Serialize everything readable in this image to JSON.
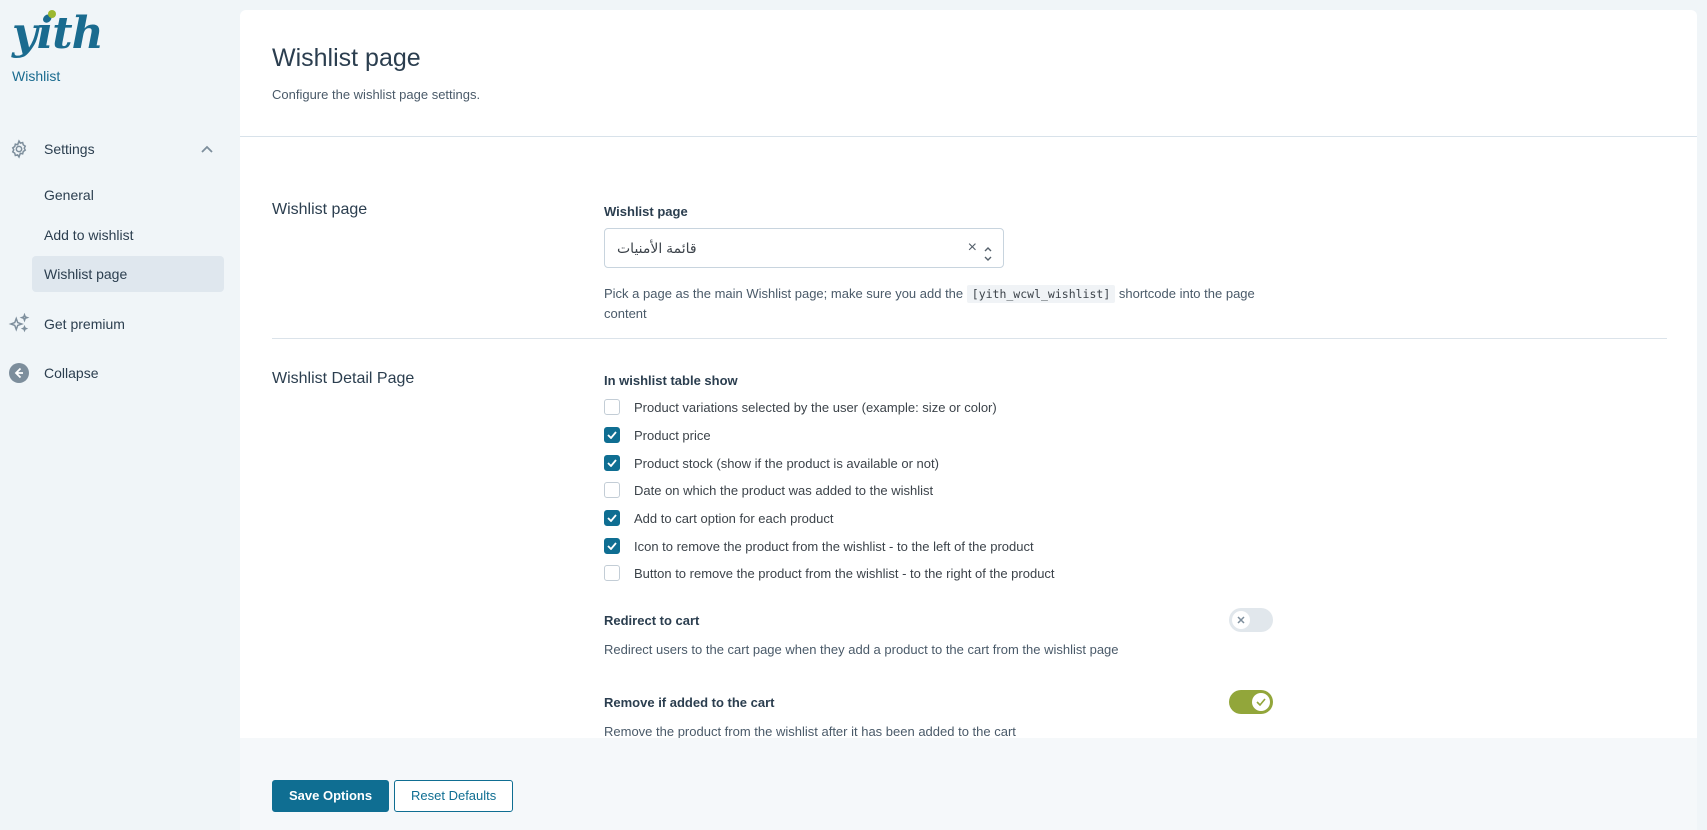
{
  "sidebar": {
    "logo_text": "yith",
    "plugin_name": "Wishlist",
    "settings_label": "Settings",
    "sub_items": [
      "General",
      "Add to wishlist",
      "Wishlist page"
    ],
    "premium_label": "Get premium",
    "collapse_label": "Collapse"
  },
  "header": {
    "title": "Wishlist page",
    "description": "Configure the wishlist page settings."
  },
  "wishlist_page_section": {
    "title": "Wishlist page",
    "field_label": "Wishlist page",
    "selected_value": "قائمة الأمنيات",
    "help_before": "Pick a page as the main Wishlist page; make sure you add the",
    "help_code": "[yith_wcwl_wishlist]",
    "help_after": "shortcode into the page content"
  },
  "detail_section": {
    "title": "Wishlist Detail Page",
    "table_label": "In wishlist table show",
    "options": [
      {
        "label": "Product variations selected by the user (example: size or color)",
        "checked": false
      },
      {
        "label": "Product price",
        "checked": true
      },
      {
        "label": "Product stock (show if the product is available or not)",
        "checked": true
      },
      {
        "label": "Date on which the product was added to the wishlist",
        "checked": false
      },
      {
        "label": "Add to cart option for each product",
        "checked": true
      },
      {
        "label": "Icon to remove the product from the wishlist - to the left of the product",
        "checked": true
      },
      {
        "label": "Button to remove the product from the wishlist - to the right of the product",
        "checked": false
      }
    ],
    "redirect_label": "Redirect to cart",
    "redirect_desc": "Redirect users to the cart page when they add a product to the cart from the wishlist page",
    "redirect_on": false,
    "remove_label": "Remove if added to the cart",
    "remove_desc": "Remove the product from the wishlist after it has been added to the cart",
    "remove_on": true
  },
  "footer": {
    "save_label": "Save Options",
    "reset_label": "Reset Defaults"
  },
  "colors": {
    "brand": "#0f6e92",
    "toggle_on": "#92a63a",
    "logo_accent": "#9cb82f"
  },
  "icons": {
    "settings": "gear-icon",
    "premium": "sparkle-icon",
    "collapse": "arrow-left-circle-icon",
    "chevron": "chevron-up-icon"
  }
}
